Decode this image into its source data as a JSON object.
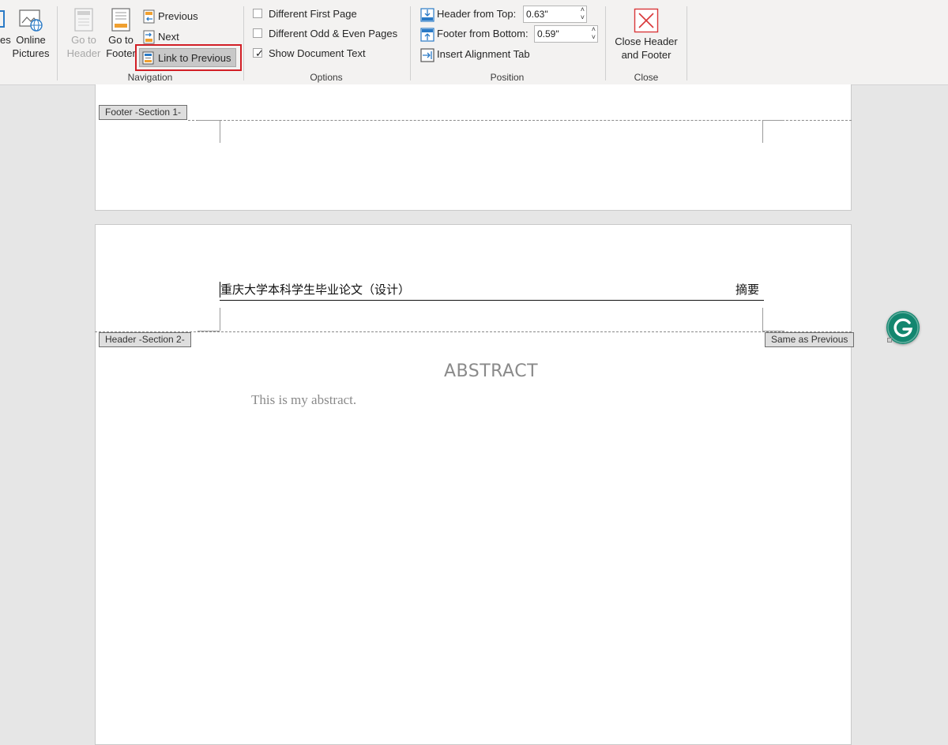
{
  "ribbon": {
    "insert_group": {
      "partial_label": "es",
      "online_pictures_line1": "Online",
      "online_pictures_line2": "Pictures"
    },
    "navigation": {
      "label": "Navigation",
      "go_to_header_line1": "Go to",
      "go_to_header_line2": "Header",
      "go_to_footer_line1": "Go to",
      "go_to_footer_line2": "Footer",
      "previous": "Previous",
      "next": "Next",
      "link_to_previous": "Link to Previous"
    },
    "options": {
      "label": "Options",
      "different_first_page": "Different First Page",
      "different_first_page_checked": false,
      "different_odd_even": "Different Odd & Even Pages",
      "different_odd_even_checked": false,
      "show_document_text": "Show Document Text",
      "show_document_text_checked": true
    },
    "position": {
      "label": "Position",
      "header_from_top_label": "Header from Top:",
      "header_from_top_value": "0.63\"",
      "footer_from_bottom_label": "Footer from Bottom:",
      "footer_from_bottom_value": "0.59\"",
      "insert_alignment_tab": "Insert Alignment Tab"
    },
    "close": {
      "label": "Close",
      "close_line1": "Close Header",
      "close_line2": "and Footer"
    }
  },
  "document": {
    "footer_section1_tag": "Footer -Section 1-",
    "header_section2_tag": "Header -Section 2-",
    "same_as_previous_tag": "Same as Previous",
    "header_left_text": "重庆大学本科学生毕业论文（设计）",
    "header_right_text": "摘要",
    "abstract_heading": "ABSTRACT",
    "abstract_body": "This is my abstract."
  },
  "colors": {
    "ribbon_bg": "#f3f2f1",
    "highlight_box": "#d21f26",
    "grammarly": "#13866f",
    "close_icon": "#d9383a"
  }
}
